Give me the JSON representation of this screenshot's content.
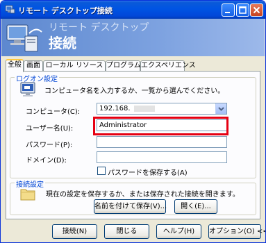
{
  "window": {
    "title": "リモート デスクトップ接続",
    "banner_line1": "リモート デスクトップ",
    "banner_line2": "接続"
  },
  "tabs": [
    {
      "label": "全般",
      "active": true
    },
    {
      "label": "画面",
      "active": false
    },
    {
      "label": "ローカル リソース",
      "active": false
    },
    {
      "label": "プログラム",
      "active": false
    },
    {
      "label": "エクスペリエンス",
      "active": false
    }
  ],
  "logon": {
    "group_label": "ログオン設定",
    "description": "コンピュータ名を入力するか、一覧から選んでください。",
    "computer_label": "コンピュータ(C):",
    "computer_value": "192.168.",
    "username_label": "ユーザー名(U):",
    "username_value": "Administrator",
    "password_label": "パスワード(P):",
    "password_value": "",
    "domain_label": "ドメイン(D):",
    "domain_value": "",
    "save_password_label": "パスワードを保存する(A)",
    "save_password_checked": false
  },
  "connection": {
    "group_label": "接続設定",
    "description": "現在の設定を保存するか、または保存された接続を開きます。",
    "save_as_button": "名前を付けて保存(V)...",
    "open_button": "開く(E)..."
  },
  "footer": {
    "connect_button": "接続(N)",
    "close_button": "閉じる",
    "help_button": "ヘルプ(H)",
    "options_button": "オプション(O) <<"
  },
  "colors": {
    "titlebar": "#0054e3",
    "highlight": "#e60012",
    "group_label": "#0046d5"
  }
}
